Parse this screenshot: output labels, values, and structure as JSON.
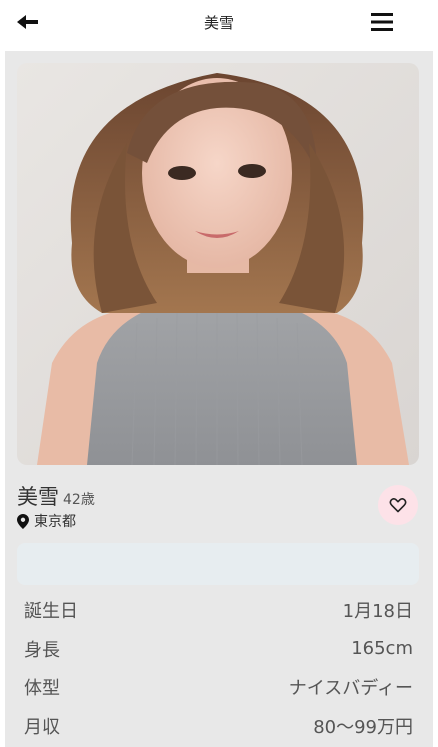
{
  "header": {
    "title": "美雪",
    "back_icon": "arrow-left-icon",
    "menu_icon": "hamburger-menu-icon"
  },
  "profile": {
    "name": "美雪",
    "age": "42歳",
    "location": "東京都",
    "location_icon": "map-pin-icon",
    "favorite_icon": "heart-outline-icon",
    "photo": "profile-photo"
  },
  "details": [
    {
      "label": "誕生日",
      "value": "1月18日"
    },
    {
      "label": "身長",
      "value": "165cm"
    },
    {
      "label": "体型",
      "value": "ナイスバディー"
    },
    {
      "label": "月収",
      "value": "80〜99万円"
    }
  ],
  "colors": {
    "favorite_bg": "#fde2e8",
    "content_bg": "#e8e8e8",
    "message_bg": "#e7edf0"
  }
}
